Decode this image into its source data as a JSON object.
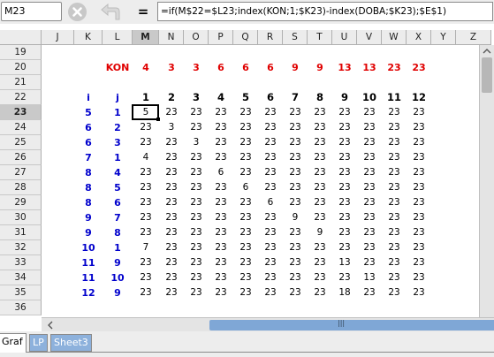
{
  "formula_bar": {
    "cell_reference": "M23",
    "formula_symbol": "=",
    "formula": "=if(M$22=$L23;index(KON;1;$K23)-index(DOBA;$K23);$E$1)"
  },
  "columns": [
    "J",
    "K",
    "L",
    "M",
    "N",
    "O",
    "P",
    "Q",
    "R",
    "S",
    "T",
    "U",
    "V",
    "W",
    "X",
    "Y",
    "Z"
  ],
  "active_column": "M",
  "rows": [
    "19",
    "20",
    "21",
    "22",
    "23",
    "24",
    "25",
    "26",
    "27",
    "28",
    "29",
    "30",
    "31",
    "32",
    "33",
    "34",
    "35",
    "36"
  ],
  "active_row": "23",
  "kon_label": "KON",
  "kon_values": [
    "4",
    "3",
    "3",
    "6",
    "6",
    "6",
    "9",
    "9",
    "13",
    "13",
    "23",
    "23"
  ],
  "header_i": "i",
  "header_j": "j",
  "header_numbers": [
    "1",
    "2",
    "3",
    "4",
    "5",
    "6",
    "7",
    "8",
    "9",
    "10",
    "11",
    "12"
  ],
  "data_rows": [
    {
      "i": "5",
      "j": "1",
      "values": [
        "5",
        "23",
        "23",
        "23",
        "23",
        "23",
        "23",
        "23",
        "23",
        "23",
        "23",
        "23"
      ]
    },
    {
      "i": "6",
      "j": "2",
      "values": [
        "23",
        "3",
        "23",
        "23",
        "23",
        "23",
        "23",
        "23",
        "23",
        "23",
        "23",
        "23"
      ]
    },
    {
      "i": "6",
      "j": "3",
      "values": [
        "23",
        "23",
        "3",
        "23",
        "23",
        "23",
        "23",
        "23",
        "23",
        "23",
        "23",
        "23"
      ]
    },
    {
      "i": "7",
      "j": "1",
      "values": [
        "4",
        "23",
        "23",
        "23",
        "23",
        "23",
        "23",
        "23",
        "23",
        "23",
        "23",
        "23"
      ]
    },
    {
      "i": "8",
      "j": "4",
      "values": [
        "23",
        "23",
        "23",
        "6",
        "23",
        "23",
        "23",
        "23",
        "23",
        "23",
        "23",
        "23"
      ]
    },
    {
      "i": "8",
      "j": "5",
      "values": [
        "23",
        "23",
        "23",
        "23",
        "6",
        "23",
        "23",
        "23",
        "23",
        "23",
        "23",
        "23"
      ]
    },
    {
      "i": "8",
      "j": "6",
      "values": [
        "23",
        "23",
        "23",
        "23",
        "23",
        "6",
        "23",
        "23",
        "23",
        "23",
        "23",
        "23"
      ]
    },
    {
      "i": "9",
      "j": "7",
      "values": [
        "23",
        "23",
        "23",
        "23",
        "23",
        "23",
        "9",
        "23",
        "23",
        "23",
        "23",
        "23"
      ]
    },
    {
      "i": "9",
      "j": "8",
      "values": [
        "23",
        "23",
        "23",
        "23",
        "23",
        "23",
        "23",
        "9",
        "23",
        "23",
        "23",
        "23"
      ]
    },
    {
      "i": "10",
      "j": "1",
      "values": [
        "7",
        "23",
        "23",
        "23",
        "23",
        "23",
        "23",
        "23",
        "23",
        "23",
        "23",
        "23"
      ]
    },
    {
      "i": "11",
      "j": "9",
      "values": [
        "23",
        "23",
        "23",
        "23",
        "23",
        "23",
        "23",
        "23",
        "13",
        "23",
        "23",
        "23"
      ]
    },
    {
      "i": "11",
      "j": "10",
      "values": [
        "23",
        "23",
        "23",
        "23",
        "23",
        "23",
        "23",
        "23",
        "23",
        "13",
        "23",
        "23"
      ]
    },
    {
      "i": "12",
      "j": "9",
      "values": [
        "23",
        "23",
        "23",
        "23",
        "23",
        "23",
        "23",
        "23",
        "18",
        "23",
        "23",
        "23"
      ]
    }
  ],
  "sheet_tabs": [
    {
      "label": "Graf",
      "active": true
    },
    {
      "label": "LP",
      "active": false
    },
    {
      "label": "Sheet3",
      "active": false
    }
  ],
  "scrollbar_grip": "|||",
  "colors": {
    "red": "#e00000",
    "blue": "#0000cc",
    "header_bg": "#ececec",
    "selected": "#000000"
  }
}
